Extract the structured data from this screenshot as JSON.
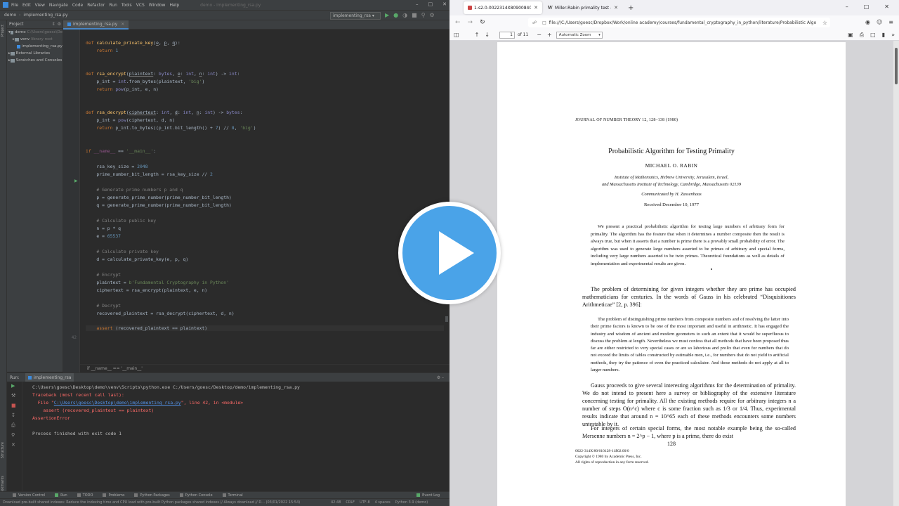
{
  "ide": {
    "menu": [
      "File",
      "Edit",
      "View",
      "Navigate",
      "Code",
      "Refactor",
      "Run",
      "Tools",
      "VCS",
      "Window",
      "Help"
    ],
    "window_title": "demo - implementing_rsa.py",
    "breadcrumbs": [
      "demo",
      "implementing_rsa.py"
    ],
    "run_config": "implementing_rsa",
    "left_tabs": [
      "Project",
      "Structure",
      "Bookmarks"
    ],
    "project_panel": {
      "title": "Project",
      "tree": [
        {
          "label": "demo",
          "path": "C:\\Users\\goesc\\De",
          "type": "folder"
        },
        {
          "label": "venv",
          "path": "library root",
          "type": "folder"
        },
        {
          "label": "implementing_rsa.py",
          "path": "",
          "type": "file"
        },
        {
          "label": "External Libraries",
          "path": "",
          "type": "folder"
        },
        {
          "label": "Scratches and Consoles",
          "path": "",
          "type": "folder"
        }
      ]
    },
    "editor_tab": "implementing_rsa.py",
    "code_breadcrumb": "if __name__ == '__main__'",
    "current_line": "42",
    "run_panel": {
      "label": "Run:",
      "tab": "implementing_rsa",
      "console": [
        "C:\\Users\\goesc\\Desktop\\demo\\venv\\Scripts\\python.exe C:/Users/goesc/Desktop/demo/implementing_rsa.py",
        "Traceback (most recent call last):",
        "  File \"",
        "C:\\Users\\goesc\\Desktop\\demo\\implementing_rsa.py",
        "\", line 42, in <module>",
        "    assert (recovered_plaintext == plaintext)",
        "AssertionError",
        "",
        "Process finished with exit code 1"
      ]
    },
    "bottom_tabs": [
      "Version Control",
      "Run",
      "TODO",
      "Problems",
      "Python Packages",
      "Python Console",
      "Terminal"
    ],
    "event_log": "Event Log",
    "status": {
      "message": "Download pre-built shared indexes: Reduce the indexing time and CPU load with pre-built Python packages shared indexes // Always download // D... (03/01/2022 15:54)",
      "position": "42:48",
      "line_sep": "CRLF",
      "encoding": "UTF-8",
      "indent": "4 spaces",
      "interpreter": "Python 3.9 (demo)"
    }
  },
  "browser": {
    "tabs": [
      {
        "title": "1-s2.0-0022314X80900840-main.pdf",
        "active": true
      },
      {
        "title": "Miller-Rabin primality test - Wik",
        "active": false
      }
    ],
    "url": "file:///C:/Users/goesc/Dropbox/Work/online academy/courses/fundamental_cryptography_in_python/literature/Probabilistic Algo",
    "pdf": {
      "page": "1",
      "page_count": "of 11",
      "zoom": "Automatic Zoom"
    }
  },
  "paper": {
    "journal": "JOURNAL OF NUMBER THEORY 12, 128–138 (1980)",
    "title": "Probabilistic Algorithm for Testing Primality",
    "author": "MICHAEL O. RABIN",
    "affil1": "Institute of Mathematics, Hebrew University, Jerusalem, Israel,",
    "affil2": "and Massachusetts Institute of Technology, Cambridge, Massachusetts 02139",
    "communicated": "Communicated by H. Zassenhaus",
    "received": "Received December 10, 1977",
    "abstract": "We present a practical probabilistic algorithm for testing large numbers of arbitrary form for primality. The algorithm has the feature that when it determines a number composite then the result is always true, but when it asserts that a number is prime there is a provably small probability of error. The algorithm was used to generate large numbers asserted to be primes of arbitrary and special forms, including very large numbers asserted to be twin primes. Theoretical foundations as well as details of implementation and experimental results are given.",
    "para1": "The problem of determining for given integers whether they are prime has occupied mathematicians for centuries. In the words of Gauss in his celebrated “Disquisitiones Arithmeticae” [2, p. 396]:",
    "quote": "The problem of distinguishing prime numbers from composite numbers and of resolving the latter into their prime factors is known to be one of the most important and useful in arithmetic. It has engaged the industry and wisdom of ancient and modern geometers to such an extent that it would be superfluous to discuss the problem at length. Nevertheless we must confess that all methods that have been proposed thus far are either restricted to very special cases or are so laborious and prolix that even for numbers that do not exceed the limits of tables constructed by estimable men, i.e., for numbers that do not yield to artificial methods, they try the patience of even the practiced calculator. And these methods do not apply at all to larger numbers.",
    "para2": "Gauss proceeds to give several interesting algorithms for the determination of primality. We do not intend to present here a survey or bibliography of the extensive literature concerning testing for primality. All the existing methods require for arbitrary integers n a number of steps O(n^c) where c is some fraction such as 1/3 or 1/4. Thus, experimental results indicate that around n = 10^65 each of these methods encounters some numbers untestable by it.",
    "para3": "For integers of certain special forms, the most notable example being the so-called Mersenne numbers n = 2^p − 1, where p is a prime, there do exist",
    "page_number": "128",
    "foot1": "0022-314X/80/010128-11$02.00/0",
    "foot2": "Copyright © 1980 by Academic Press, Inc.",
    "foot3": "All rights of reproduction in any form reserved."
  },
  "colors": {
    "ide_bg": "#2b2b2b",
    "keyword": "#cc7832",
    "function": "#ffc66d",
    "string": "#6a8759",
    "number": "#6897bb",
    "error": "#ff6b68",
    "play_blue": "#4aa3e8"
  },
  "icons": [
    "play-triangle-icon",
    "run-icon",
    "debug-icon",
    "folder-icon",
    "python-file-icon",
    "reload-icon",
    "star-icon",
    "shield-icon"
  ]
}
